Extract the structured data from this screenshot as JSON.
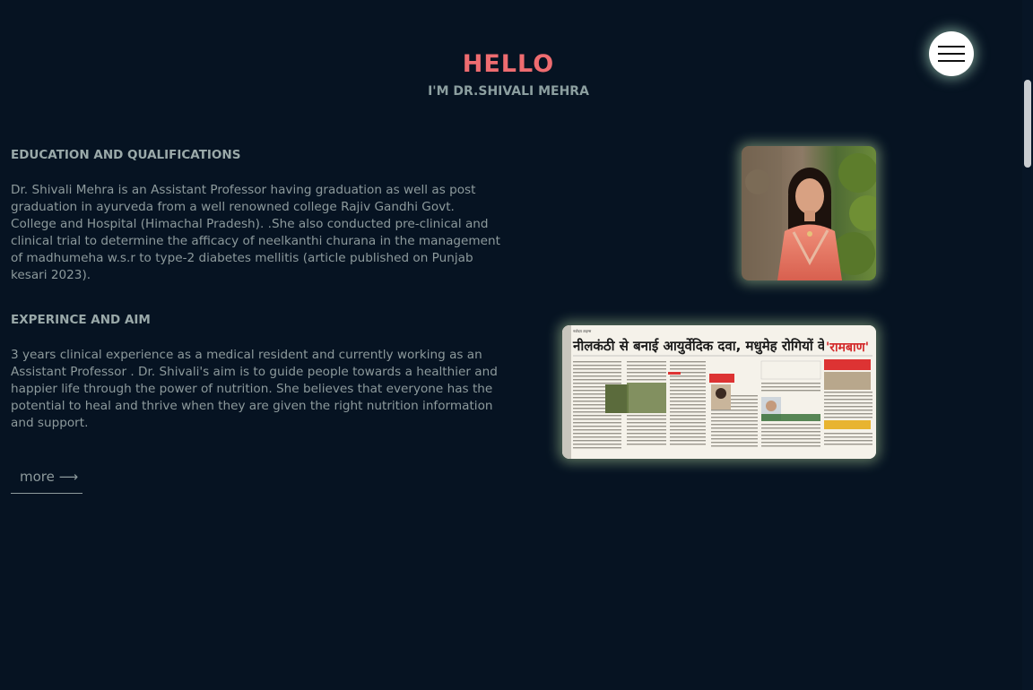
{
  "hero": {
    "title": "HELLO",
    "subtitle": "I'M DR.SHIVALI MEHRA"
  },
  "menu": {
    "icon": "hamburger-menu-icon"
  },
  "education": {
    "heading": "EDUCATION AND QUALIFICATIONS",
    "text": "Dr. Shivali Mehra is an Assistant Professor having graduation as well as post graduation in ayurveda from a well renowned college Rajiv Gandhi Govt. College and Hospital (Himachal Pradesh). .She also conducted pre-clinical and clinical trial to determine the afficacy of neelkanthi churana in the management of madhumeha w.s.r to type-2 diabetes mellitis (article published on Punjab kesari 2023)."
  },
  "experience": {
    "heading": "EXPERINCE AND AIM",
    "text": "3 years clinical experience as a medical resident and currently working as an Assistant Professor . Dr. Shivali's aim is to guide people towards a healthier and happier life through the power of nutrition. She believes that everyone has the potential to heal and thrive when they are given the right nutrition information and support."
  },
  "more_link": {
    "label": "more ⟶"
  },
  "newspaper": {
    "headline": "नीलकंठी से बनाई आयुर्वेदिक दवा, मधुमेह रोगियों के लिए",
    "highlight": "'रामबाण'"
  },
  "colors": {
    "background": "#061322",
    "accent": "#ee6c70",
    "heading": "#9aa9a9",
    "body_text": "#8d9a9c",
    "glow": "#c8ebaa"
  }
}
